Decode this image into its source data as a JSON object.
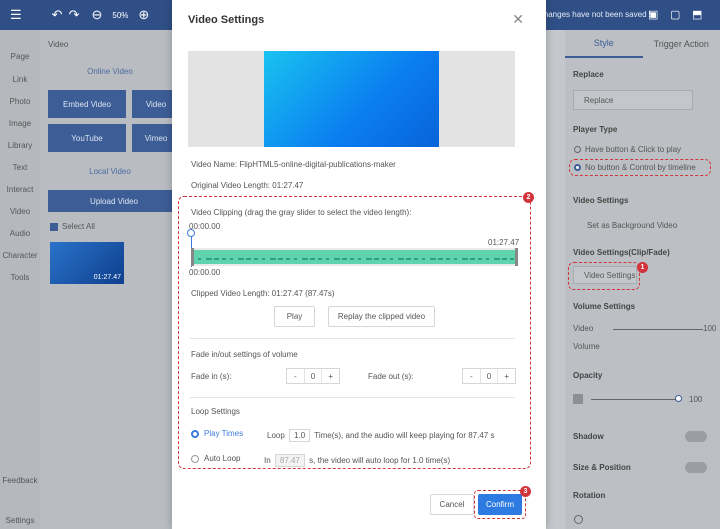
{
  "topbar": {
    "zoom": "50%",
    "notice": "Changes have not been saved !"
  },
  "leftnav": [
    "Page",
    "Link",
    "Photo",
    "Image",
    "Library",
    "Text",
    "Interact",
    "Video",
    "Audio",
    "Character",
    "Tools",
    "Feedback",
    "Settings"
  ],
  "lpanel": {
    "header": "Video",
    "online_title": "Online Video",
    "buttons": [
      "Embed Video",
      "Video",
      "YouTube",
      "Vimeo"
    ],
    "local_title": "Local Video",
    "upload": "Upload Video",
    "select_all": "Select All",
    "thumb_time": "01:27.47"
  },
  "rpanel": {
    "tabs": [
      "Style",
      "Trigger Action"
    ],
    "replace_label": "Replace",
    "replace_btn": "Replace",
    "player_type_label": "Player Type",
    "player_opt1": "Have button & Click to play",
    "player_opt2": "No button & Control by timeline",
    "video_settings_label": "Video Settings",
    "set_bg": "Set as Background Video",
    "clip_fade_label": "Video Settings(Clip/Fade)",
    "video_settings_btn": "Video Settings",
    "volume_label": "Volume Settings",
    "video_txt": "Video",
    "volume_txt": "Volume",
    "volume_val": "100",
    "opacity_label": "Opacity",
    "opacity_val": "100",
    "shadow_label": "Shadow",
    "size_label": "Size & Position",
    "rotation_label": "Rotation"
  },
  "dialog": {
    "title": "Video Settings",
    "video_name": "Video Name: FlipHTML5-online-digital-publications-maker",
    "original_length": "Original Video Length: 01:27.47",
    "clip_hint": "Video Clipping (drag the gray slider to select the video length):",
    "start_time": "00:00.00",
    "end_time": "01:27.47",
    "bottom_time": "00:00.00",
    "clipped_length": "Clipped Video Length: 01:27.47 (87.47s)",
    "play_btn": "Play",
    "replay_btn": "Replay the clipped video",
    "fade_title": "Fade in/out settings of volume",
    "fade_in_label": "Fade in (s):",
    "fade_in_val": "0",
    "fade_out_label": "Fade out (s):",
    "fade_out_val": "0",
    "minus": "-",
    "plus": "+",
    "loop_title": "Loop Settings",
    "play_times": "Play Times",
    "loop_word": "Loop",
    "loop_val": "1.0",
    "loop_tail": "Time(s), and the audio will keep playing for 87.47 s",
    "auto_loop": "Auto Loop",
    "in_word": "In",
    "auto_val": "87.47",
    "auto_tail": "s, the video will auto loop for 1.0 time(s)",
    "cancel": "Cancel",
    "confirm": "Confirm"
  },
  "badges": [
    "1",
    "2",
    "3"
  ],
  "colors": {
    "accent": "#2d7be0",
    "annotation": "#d1343a",
    "wave": "#5fd3ad"
  }
}
